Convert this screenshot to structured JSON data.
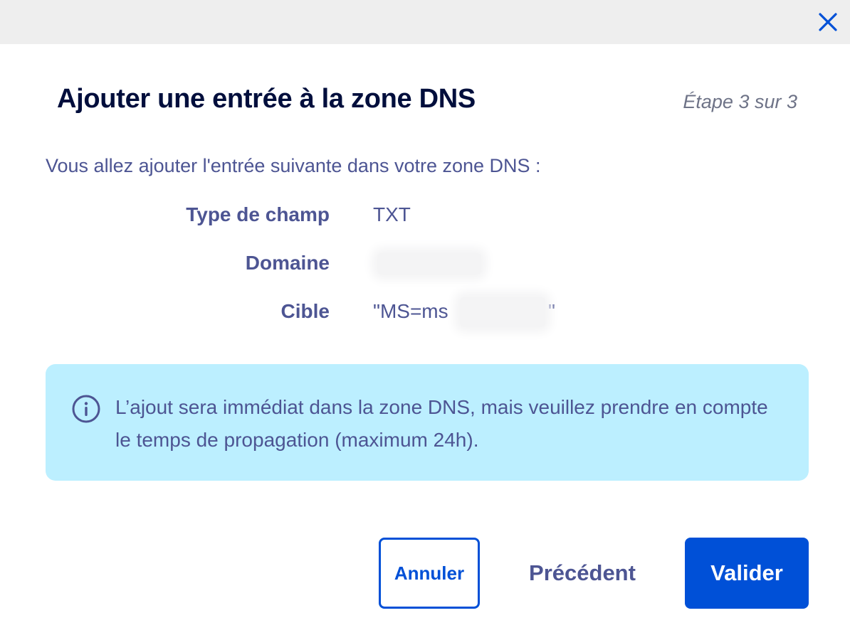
{
  "dialog": {
    "title": "Ajouter une entrée à la zone DNS",
    "step": "Étape 3 sur 3",
    "intro": "Vous allez ajouter l'entrée suivante dans votre zone DNS :"
  },
  "fields": [
    {
      "label": "Type de champ",
      "value": "TXT"
    },
    {
      "label": "Domaine",
      "value": ""
    },
    {
      "label": "Cible",
      "value": "\"MS=ms",
      "value_suffix": "\""
    }
  ],
  "info": {
    "icon": "info-circle-icon",
    "text": "L’ajout sera immédiat dans la zone DNS, mais veuillez prendre en compte le temps de propagation (maximum 24h)."
  },
  "buttons": {
    "cancel": "Annuler",
    "previous": "Précédent",
    "validate": "Valider"
  },
  "colors": {
    "primary": "#0050d7",
    "title": "#000e3c",
    "text": "#4d5593",
    "info_background": "#bcefff",
    "topbar": "#eeeeee"
  }
}
